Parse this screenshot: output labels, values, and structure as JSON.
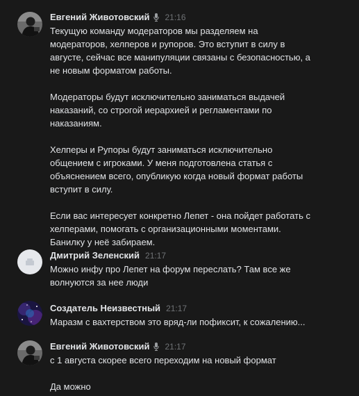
{
  "messages": [
    {
      "author": "Евгений Животовский",
      "time": "21:16",
      "avatar": "user-photo-dark",
      "badge": "mic-icon",
      "lines": [
        "Текущую команду модераторов мы разделяем на",
        "модераторов, хелперов и рупоров. Это вступит в силу в",
        "августе, сейчас все манипуляции связаны с безопасностью, а",
        "не новым форматом работы.",
        "",
        "Модераторы будут исключительно заниматься выдачей",
        "наказаний, со строгой иерархией и регламентами по",
        "наказаниям.",
        "",
        "Хелперы и Рупоры будут заниматься исключительно",
        "общением с игроками. У меня подготовлена статья с",
        "объяснением всего, опубликую когда новый формат работы",
        "вступит в силу.",
        "",
        "Если вас интересует конкретно Лепет - она пойдет работать с",
        "хелперами, помогать с организационными моментами.",
        "Банилку у неё забираем."
      ]
    },
    {
      "author": "Дмитрий Зеленский",
      "time": "21:17",
      "avatar": "default-avatar",
      "lines": [
        "Можно инфу про Лепет на форум переслать? Там все же",
        "волнуются за нее люди"
      ]
    },
    {
      "author": "Создатель Неизвестный",
      "time": "21:17",
      "avatar": "space-avatar",
      "lines": [
        "Маразм с вахтерством это вряд-ли пофиксит, к сожалению..."
      ]
    },
    {
      "author": "Евгений Животовский",
      "time": "21:17",
      "avatar": "user-photo-dark",
      "badge": "mic-icon",
      "lines": [
        "с 1 августа скорее всего переходим на новый формат",
        "",
        "Да можно"
      ]
    }
  ],
  "colors": {
    "background": "#191919",
    "text": "#e1e3e6",
    "time": "#6f7275"
  }
}
